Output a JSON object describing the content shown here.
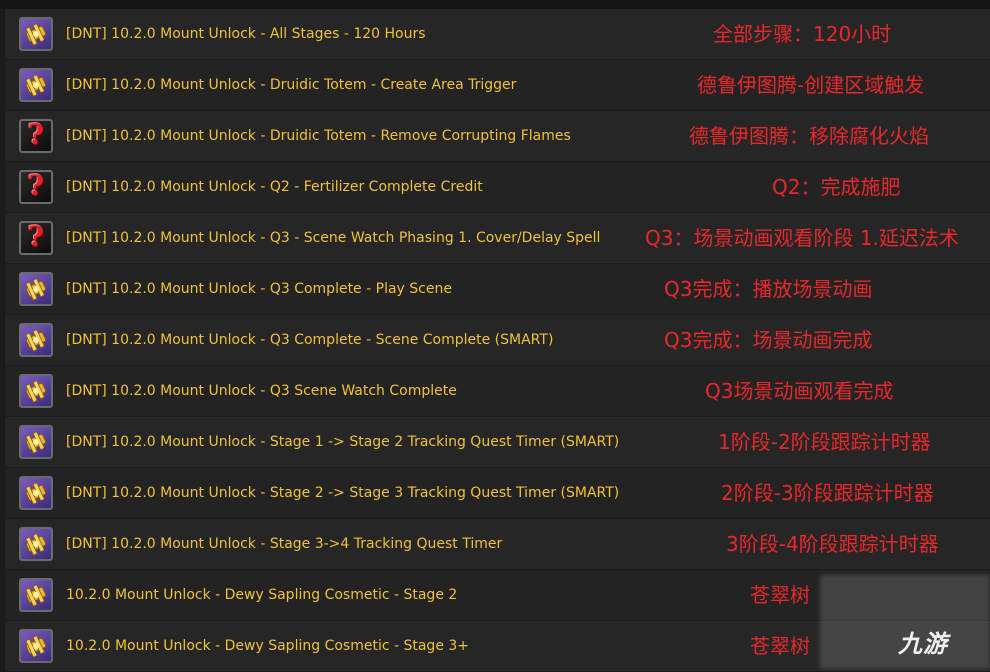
{
  "rows": [
    {
      "title": "[DNT] 10.2.0 Mount Unlock - All Stages - 120 Hours",
      "annotation": "全部步骤：120小时",
      "icon": "gear-icon"
    },
    {
      "title": "[DNT] 10.2.0 Mount Unlock - Druidic Totem - Create Area Trigger",
      "annotation": "德鲁伊图腾-创建区域触发",
      "icon": "gear-icon"
    },
    {
      "title": "[DNT] 10.2.0 Mount Unlock - Druidic Totem - Remove Corrupting Flames",
      "annotation": "德鲁伊图腾：移除腐化火焰",
      "icon": "question-mark-icon"
    },
    {
      "title": "[DNT] 10.2.0 Mount Unlock - Q2 - Fertilizer Complete Credit",
      "annotation": "Q2：完成施肥",
      "icon": "question-mark-icon"
    },
    {
      "title": "[DNT] 10.2.0 Mount Unlock - Q3 - Scene Watch Phasing 1. Cover/Delay Spell",
      "annotation": "Q3：场景动画观看阶段 1.延迟法术",
      "icon": "question-mark-icon"
    },
    {
      "title": "[DNT] 10.2.0 Mount Unlock - Q3 Complete - Play Scene",
      "annotation": "Q3完成：播放场景动画",
      "icon": "gear-icon"
    },
    {
      "title": "[DNT] 10.2.0 Mount Unlock - Q3 Complete - Scene Complete (SMART)",
      "annotation": "Q3完成：场景动画完成",
      "icon": "gear-icon"
    },
    {
      "title": "[DNT] 10.2.0 Mount Unlock - Q3 Scene Watch Complete",
      "annotation": "Q3场景动画观看完成",
      "icon": "gear-icon"
    },
    {
      "title": "[DNT] 10.2.0 Mount Unlock - Stage 1 -> Stage 2 Tracking Quest Timer (SMART)",
      "annotation": "1阶段-2阶段跟踪计时器",
      "icon": "gear-icon"
    },
    {
      "title": "[DNT] 10.2.0 Mount Unlock - Stage 2 -> Stage 3 Tracking Quest Timer (SMART)",
      "annotation": "2阶段-3阶段跟踪计时器",
      "icon": "gear-icon"
    },
    {
      "title": "[DNT] 10.2.0 Mount Unlock - Stage 3->4 Tracking Quest Timer",
      "annotation": "3阶段-4阶段跟踪计时器",
      "icon": "gear-icon"
    },
    {
      "title": "10.2.0 Mount Unlock - Dewy Sapling Cosmetic - Stage 2",
      "annotation": "苍翠树",
      "icon": "gear-icon"
    },
    {
      "title": "10.2.0 Mount Unlock - Dewy Sapling Cosmetic - Stage 3+",
      "annotation": "苍翠树",
      "icon": "gear-icon"
    }
  ],
  "watermark": {
    "logo_text": "九游"
  },
  "colors": {
    "title": "#f1c232",
    "annotation": "#e8282b",
    "row_bg": "#262626"
  }
}
